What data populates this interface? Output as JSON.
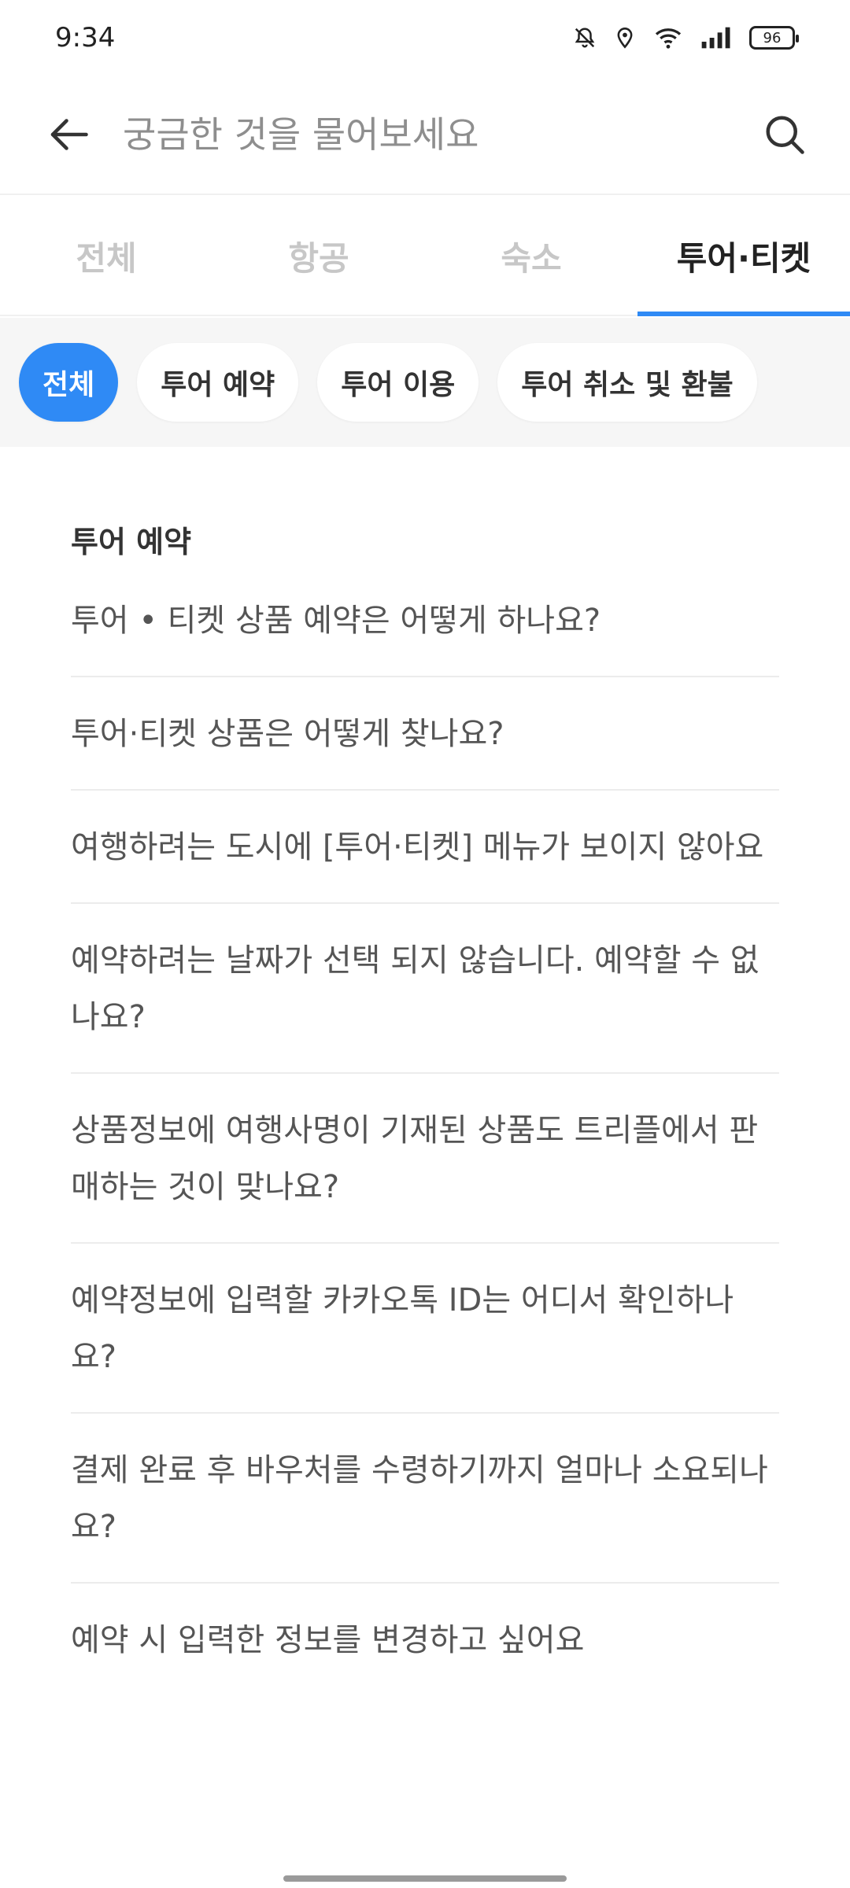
{
  "status_bar": {
    "time": "9:34",
    "battery": "96"
  },
  "search": {
    "placeholder": "궁금한 것을 물어보세요"
  },
  "tabs": [
    {
      "label": "전체",
      "active": false
    },
    {
      "label": "항공",
      "active": false
    },
    {
      "label": "숙소",
      "active": false
    },
    {
      "label": "투어·티켓",
      "active": true
    }
  ],
  "chips": [
    {
      "label": "전체",
      "active": true
    },
    {
      "label": "투어 예약",
      "active": false
    },
    {
      "label": "투어 이용",
      "active": false
    },
    {
      "label": "투어 취소 및 환불",
      "active": false
    }
  ],
  "section": {
    "title": "투어 예약"
  },
  "faqs": [
    "투어 • 티켓 상품 예약은 어떻게 하나요?",
    "투어·티켓 상품은 어떻게 찾나요?",
    "여행하려는 도시에 [투어·티켓] 메뉴가 보이지 않아요",
    "예약하려는 날짜가 선택 되지 않습니다. 예약할 수 없나요?",
    "상품정보에 여행사명이 기재된 상품도 트리플에서 판매하는 것이 맞나요?",
    "예약정보에 입력할 카카오톡 ID는 어디서 확인하나요?",
    "결제 완료 후 바우처를 수령하기까지 얼마나 소요되나요?",
    "예약 시 입력한 정보를 변경하고 싶어요"
  ],
  "colors": {
    "accent": "#2f8af5",
    "inactive_tab": "#c7c7c7",
    "chip_bar_bg": "#f6f6f6"
  },
  "icons": {
    "back": "arrow-left-icon",
    "search": "search-icon"
  }
}
